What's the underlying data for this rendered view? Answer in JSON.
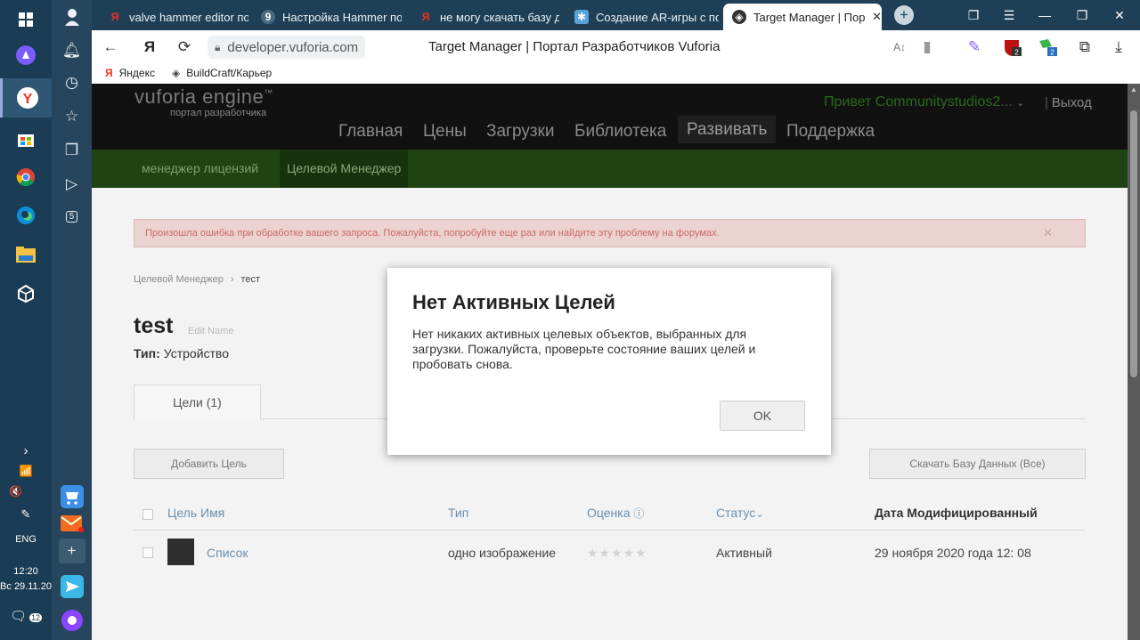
{
  "taskbar": {
    "time": "12:20",
    "date": "Вс 29.11.20",
    "language": "ENG",
    "notifications_count": "12"
  },
  "browser": {
    "tabs": [
      {
        "label": "valve hammer editor под",
        "icon": "yandex-icon"
      },
      {
        "label": "Настройка Hammer под С",
        "icon": "site-icon"
      },
      {
        "label": "не могу скачать базу да",
        "icon": "yandex-icon"
      },
      {
        "label": "Создание AR-игры с пом",
        "icon": "site-icon"
      },
      {
        "label": "Target Manager | Пор",
        "icon": "unity-icon",
        "active": true
      }
    ],
    "url": "developer.vuforia.com",
    "page_title": "Target Manager | Портал Разработчиков Vuforia",
    "bookmarks": [
      "Яндекс",
      "BuildCraft/Карьер"
    ],
    "extension_badge_1": "2",
    "extension_badge_2": "2"
  },
  "site": {
    "logo": "vuforia engine",
    "logo_tm": "™",
    "logo_sub": "портал разработчика",
    "greeting": "Привет Communitystudios2...",
    "logout": "Выход",
    "nav": [
      "Главная",
      "Цены",
      "Загрузки",
      "Библиотека",
      "Развивать",
      "Поддержка"
    ],
    "subnav": [
      "менеджер лицензий",
      "Целевой Менеджер"
    ],
    "error": "Произошла ошибка при обработке вашего запроса. Пожалуйста, попробуйте еще раз или найдите эту проблему на форумах.",
    "breadcrumb": [
      "Целевой Менеджер",
      "тест"
    ],
    "db_name": "test",
    "edit_name": "Edit Name",
    "type_label": "Тип:",
    "type_value": "Устройство",
    "tab_targets": "Цели (1)",
    "add_target": "Добавить Цель",
    "download_db": "Скачать Базу Данных (Все)",
    "columns": [
      "Цель Имя",
      "Тип",
      "Оценка",
      "Статус",
      "Дата Модифицированный"
    ],
    "rows": [
      {
        "name": "Список",
        "type": "одно изображение",
        "rating": "★★★★★",
        "status": "Активный",
        "date": "29 ноября 2020 года 12: 08"
      }
    ]
  },
  "modal": {
    "title": "Нет Активных Целей",
    "body": "Нет никаких активных целевых объектов, выбранных для загрузки. Пожалуйста, проверьте состояние ваших целей и пробовать снова.",
    "ok": "OK"
  }
}
